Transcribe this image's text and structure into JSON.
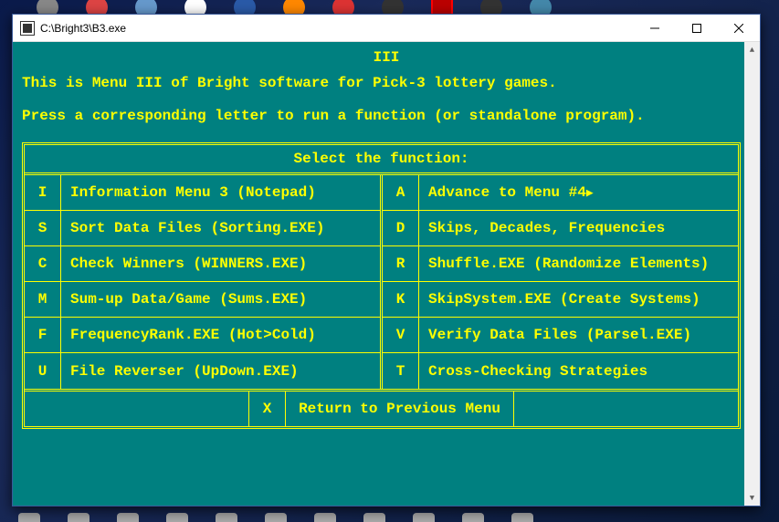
{
  "window": {
    "title": "C:\\Bright3\\B3.exe"
  },
  "console": {
    "menu_number": "III",
    "intro1": "This is Menu III of Bright software for Pick-3 lottery games.",
    "intro2": "Press a corresponding letter to run a function (or standalone program).",
    "select_header": "Select the function:",
    "left": [
      {
        "key": "I",
        "label": "Information Menu 3 (Notepad)"
      },
      {
        "key": "S",
        "label": "Sort Data Files (Sorting.EXE)"
      },
      {
        "key": "C",
        "label": "Check Winners (WINNERS.EXE)"
      },
      {
        "key": "M",
        "label": "Sum-up Data/Game (Sums.EXE)"
      },
      {
        "key": "F",
        "label": "FrequencyRank.EXE (Hot>Cold)"
      },
      {
        "key": "U",
        "label": "File Reverser (UpDown.EXE)"
      }
    ],
    "right": [
      {
        "key": "A",
        "label": "Advance to Menu #4"
      },
      {
        "key": "D",
        "label": "Skips, Decades, Frequencies"
      },
      {
        "key": "R",
        "label": "Shuffle.EXE (Randomize Elements)"
      },
      {
        "key": "K",
        "label": "SkipSystem.EXE (Create Systems)"
      },
      {
        "key": "V",
        "label": "Verify Data Files (Parsel.EXE)"
      },
      {
        "key": "T",
        "label": "Cross-Checking Strategies"
      }
    ],
    "footer": {
      "key": "X",
      "label": "Return to Previous Menu"
    }
  }
}
